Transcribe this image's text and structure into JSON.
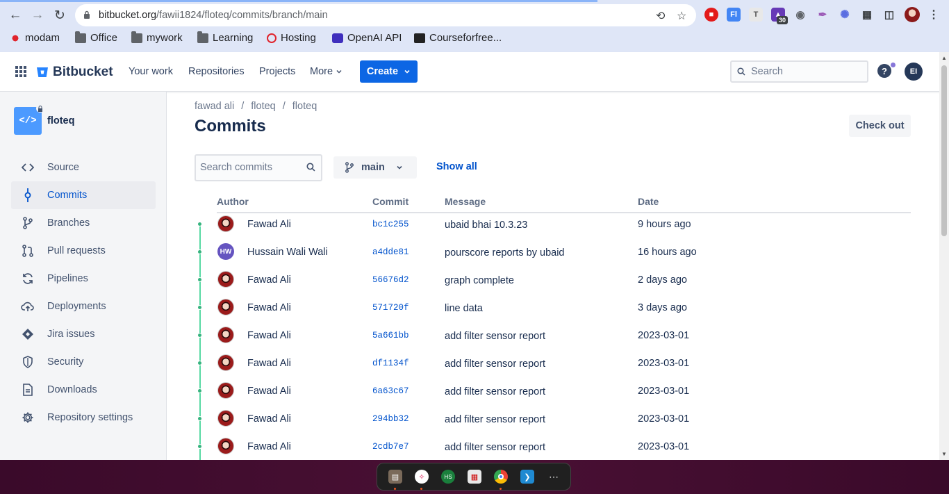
{
  "browser": {
    "url_host": "bitbucket.org",
    "url_path": "/fawii1824/floteq/commits/branch/main",
    "extension_badge": "30",
    "bookmarks": [
      {
        "label": "modam",
        "icon": "huawei-icon"
      },
      {
        "label": "Office",
        "icon": "folder-icon"
      },
      {
        "label": "mywork",
        "icon": "folder-icon"
      },
      {
        "label": "Learning",
        "icon": "folder-icon"
      },
      {
        "label": "Hosting",
        "icon": "hosting-icon"
      },
      {
        "label": "OpenAI API",
        "icon": "openai-icon"
      },
      {
        "label": "Courseforfree...",
        "icon": "course-icon"
      }
    ]
  },
  "topbar": {
    "product": "Bitbucket",
    "nav": [
      "Your work",
      "Repositories",
      "Projects",
      "More"
    ],
    "create_label": "Create",
    "search_placeholder": "Search",
    "avatar_initials": "EI",
    "help_symbol": "?"
  },
  "sidebar": {
    "repo_name": "floteq",
    "repo_icon_glyph": "</>",
    "items": [
      {
        "label": "Source",
        "icon": "code-icon",
        "active": false
      },
      {
        "label": "Commits",
        "icon": "commit-icon",
        "active": true
      },
      {
        "label": "Branches",
        "icon": "branch-icon",
        "active": false
      },
      {
        "label": "Pull requests",
        "icon": "pull-request-icon",
        "active": false
      },
      {
        "label": "Pipelines",
        "icon": "pipelines-icon",
        "active": false
      },
      {
        "label": "Deployments",
        "icon": "cloud-upload-icon",
        "active": false
      },
      {
        "label": "Jira issues",
        "icon": "jira-icon",
        "active": false
      },
      {
        "label": "Security",
        "icon": "shield-icon",
        "active": false
      },
      {
        "label": "Downloads",
        "icon": "document-icon",
        "active": false
      },
      {
        "label": "Repository settings",
        "icon": "gear-icon",
        "active": false
      }
    ]
  },
  "main": {
    "breadcrumb": [
      "fawad ali",
      "floteq",
      "floteq"
    ],
    "breadcrumb_sep": "/",
    "title": "Commits",
    "checkout_label": "Check out",
    "search_placeholder": "Search commits",
    "branch": "main",
    "show_all_label": "Show all",
    "columns": [
      "Author",
      "Commit",
      "Message",
      "Date"
    ],
    "commits": [
      {
        "author": "Fawad Ali",
        "avatar": "photo",
        "hash": "bc1c255",
        "message": "ubaid bhai 10.3.23",
        "date": "9 hours ago"
      },
      {
        "author": "Hussain Wali Wali",
        "avatar": "HW",
        "hash": "a4dde81",
        "message": "pourscore reports by ubaid",
        "date": "16 hours ago"
      },
      {
        "author": "Fawad Ali",
        "avatar": "photo",
        "hash": "56676d2",
        "message": "graph complete",
        "date": "2 days ago"
      },
      {
        "author": "Fawad Ali",
        "avatar": "photo",
        "hash": "571720f",
        "message": "line data",
        "date": "3 days ago"
      },
      {
        "author": "Fawad Ali",
        "avatar": "photo",
        "hash": "5a661bb",
        "message": "add filter sensor report",
        "date": "2023-03-01"
      },
      {
        "author": "Fawad Ali",
        "avatar": "photo",
        "hash": "df1134f",
        "message": "add filter sensor report",
        "date": "2023-03-01"
      },
      {
        "author": "Fawad Ali",
        "avatar": "photo",
        "hash": "6a63c67",
        "message": "add filter sensor report",
        "date": "2023-03-01"
      },
      {
        "author": "Fawad Ali",
        "avatar": "photo",
        "hash": "294bb32",
        "message": "add filter sensor report",
        "date": "2023-03-01"
      },
      {
        "author": "Fawad Ali",
        "avatar": "photo",
        "hash": "2cdb7e7",
        "message": "add filter sensor report",
        "date": "2023-03-01"
      }
    ]
  },
  "colors": {
    "brand": "#0052cc",
    "create_button": "#0c66e4",
    "timeline": "#57d9a3",
    "sidebar_bg": "#f4f5f7"
  },
  "dock_apps": [
    "files-icon",
    "slack-icon",
    "hosting-app-icon",
    "calculator-icon",
    "chrome-icon",
    "vscode-icon",
    "app-grid-icon"
  ]
}
